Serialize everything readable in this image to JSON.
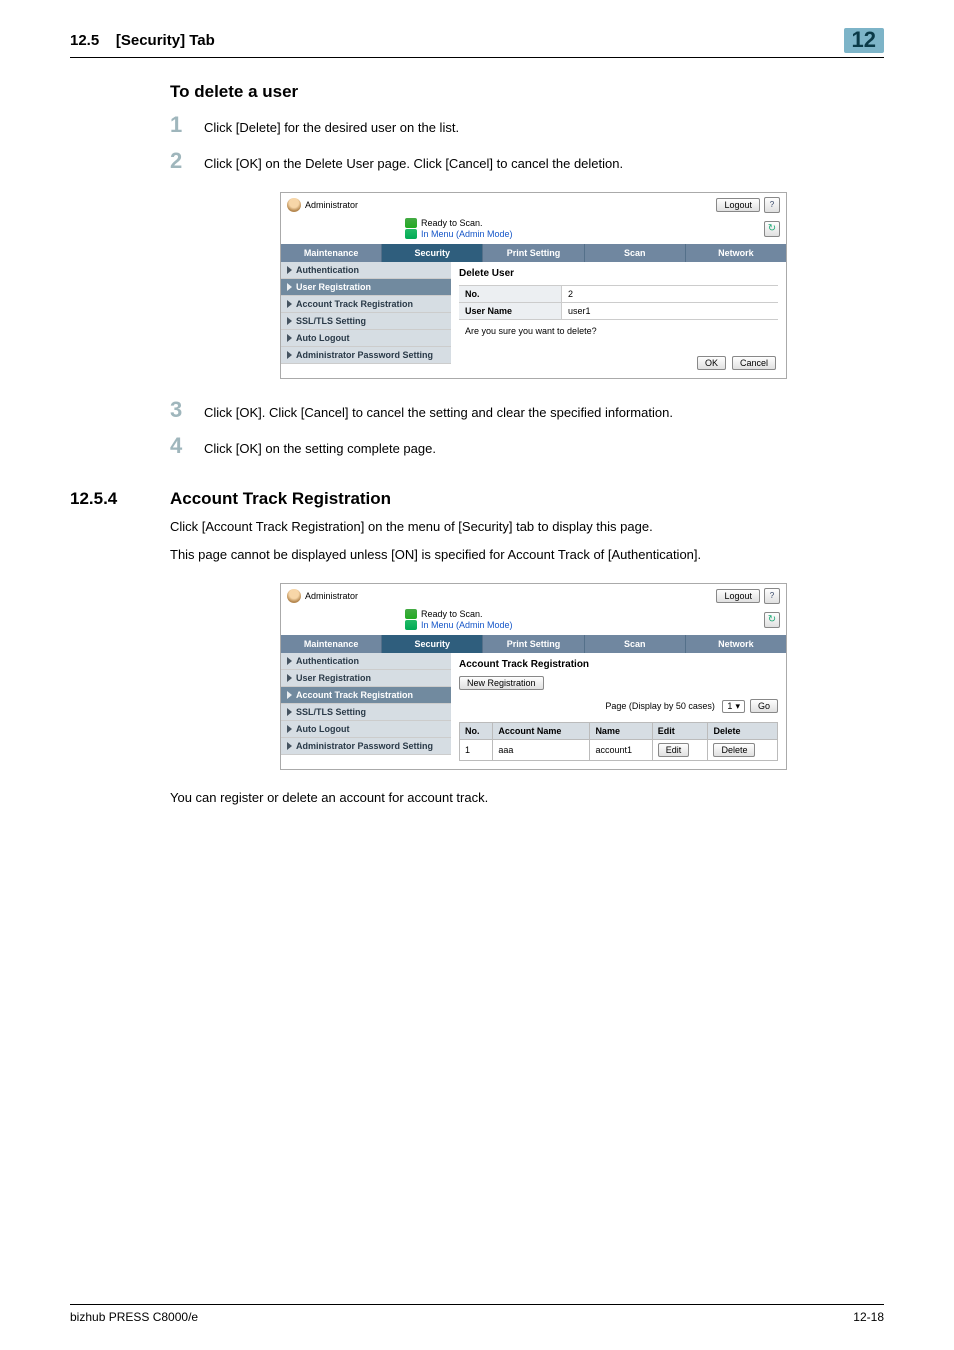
{
  "page_header": {
    "section_number": "12.5",
    "section_title": "[Security] Tab",
    "chapter": "12"
  },
  "section_a": {
    "heading": "To delete a user",
    "steps": {
      "s1": {
        "num": "1",
        "text": "Click [Delete] for the desired user on the list."
      },
      "s2": {
        "num": "2",
        "text": "Click [OK] on the Delete User page. Click [Cancel] to cancel the deletion."
      },
      "s3": {
        "num": "3",
        "text": "Click [OK]. Click [Cancel] to cancel the setting and clear the specified information."
      },
      "s4": {
        "num": "4",
        "text": "Click [OK] on the setting complete page."
      }
    }
  },
  "section_b": {
    "num": "12.5.4",
    "title": "Account Track Registration",
    "p1": "Click [Account Track Registration] on the menu of [Security] tab to display this page.",
    "p2": "This page cannot be displayed unless [ON] is specified for Account Track of [Authentication].",
    "closing": "You can register or delete an account for account track."
  },
  "shot_common": {
    "role": "Administrator",
    "logout": "Logout",
    "help_glyph": "?",
    "status1": "Ready to Scan.",
    "status2": "In Menu (Admin Mode)",
    "refresh_glyph": "↻",
    "tabs": {
      "maintenance": "Maintenance",
      "security": "Security",
      "print_setting": "Print Setting",
      "scan": "Scan",
      "network": "Network"
    },
    "sidebar": {
      "authentication": "Authentication",
      "user_registration": "User Registration",
      "account_track_registration": "Account Track Registration",
      "ssl_tls": "SSL/TLS Setting",
      "auto_logout": "Auto Logout",
      "admin_pw": "Administrator Password Setting"
    },
    "buttons": {
      "ok": "OK",
      "cancel": "Cancel",
      "edit": "Edit",
      "delete": "Delete",
      "go": "Go",
      "new_registration": "New Registration"
    }
  },
  "shot1": {
    "main_title": "Delete User",
    "no_label": "No.",
    "no_value": "2",
    "user_name_label": "User Name",
    "user_name_value": "user1",
    "confirm": "Are you sure you want to delete?"
  },
  "shot2": {
    "main_title": "Account Track Registration",
    "pager_label": "Page (Display by 50 cases)",
    "page_value": "1",
    "cols": {
      "no": "No.",
      "account_name": "Account Name",
      "name": "Name",
      "edit": "Edit",
      "delete": "Delete"
    },
    "row1": {
      "no": "1",
      "account_name": "aaa",
      "name": "account1"
    }
  },
  "footer": {
    "left": "bizhub PRESS C8000/e",
    "right": "12-18"
  }
}
